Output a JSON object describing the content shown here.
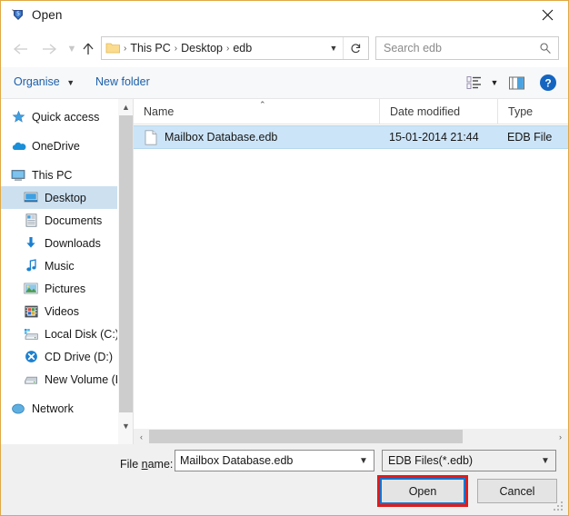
{
  "window": {
    "title": "Open",
    "app_icon": "app-shield-icon",
    "close_label": "✕",
    "border_color": "#e0a945"
  },
  "nav": {
    "back_icon": "back-arrow-icon",
    "forward_icon": "forward-arrow-icon",
    "recent_icon": "recent-locations-chevron-icon",
    "up_icon": "up-arrow-icon",
    "breadcrumbs": [
      "This PC",
      "Desktop",
      "edb"
    ],
    "separator": "›",
    "dropdown_icon": "chevron-down-icon",
    "refresh_icon": "refresh-icon"
  },
  "search": {
    "placeholder": "Search edb",
    "icon": "search-icon"
  },
  "command_bar": {
    "organise_label": "Organise",
    "organise_caret": "▼",
    "new_folder_label": "New folder",
    "view_mode_icon": "view-options-icon",
    "view_mode_caret": "▼",
    "preview_pane_icon": "preview-pane-icon",
    "help_icon": "help-icon",
    "link_color": "#1b5fa8"
  },
  "sidebar": {
    "items": [
      {
        "label": "Quick access",
        "icon": "quick-access-star-icon",
        "indent": false,
        "selected": false
      },
      {
        "label": "OneDrive",
        "icon": "onedrive-cloud-icon",
        "indent": false,
        "selected": false
      },
      {
        "label": "This PC",
        "icon": "this-pc-monitor-icon",
        "indent": false,
        "selected": false
      },
      {
        "label": "Desktop",
        "icon": "desktop-icon",
        "indent": true,
        "selected": true
      },
      {
        "label": "Documents",
        "icon": "documents-icon",
        "indent": true,
        "selected": false
      },
      {
        "label": "Downloads",
        "icon": "downloads-arrow-icon",
        "indent": true,
        "selected": false
      },
      {
        "label": "Music",
        "icon": "music-note-icon",
        "indent": true,
        "selected": false
      },
      {
        "label": "Pictures",
        "icon": "pictures-icon",
        "indent": true,
        "selected": false
      },
      {
        "label": "Videos",
        "icon": "videos-icon",
        "indent": true,
        "selected": false
      },
      {
        "label": "Local Disk (C:)",
        "icon": "local-disk-icon",
        "indent": true,
        "selected": false
      },
      {
        "label": "CD Drive (D:)",
        "icon": "cd-drive-icon",
        "indent": true,
        "selected": false
      },
      {
        "label": "New Volume (E:)",
        "icon": "new-volume-disk-icon",
        "indent": true,
        "selected": false
      },
      {
        "label": "Network",
        "icon": "network-icon",
        "indent": false,
        "selected": false
      }
    ],
    "scroll_up_icon": "chevron-up-icon",
    "scroll_down_icon": "chevron-down-icon"
  },
  "file_list": {
    "columns": [
      "Name",
      "Date modified",
      "Type"
    ],
    "sort_indicator": "⌃",
    "rows": [
      {
        "name": "Mailbox Database.edb",
        "date_modified": "15-01-2014 21:44",
        "type": "EDB File",
        "icon": "file-icon",
        "selected": true
      }
    ],
    "selection_color": "#cce4f7",
    "scroll_left_icon": "‹",
    "scroll_right_icon": "›"
  },
  "footer": {
    "file_name_label_pre": "File ",
    "file_name_label_underlined": "n",
    "file_name_label_post": "ame:",
    "file_name_value": "Mailbox Database.edb",
    "file_name_dropdown_icon": "chevron-down-icon",
    "file_type_value": "EDB Files(*.edb)",
    "file_type_dropdown_icon": "chevron-down-icon",
    "open_label_pre": "",
    "open_label": "Open",
    "cancel_label": "Cancel",
    "highlight_color": "#e01b1b",
    "focus_color": "#1176d0",
    "resize_grip_icon": "resize-grip-icon"
  }
}
